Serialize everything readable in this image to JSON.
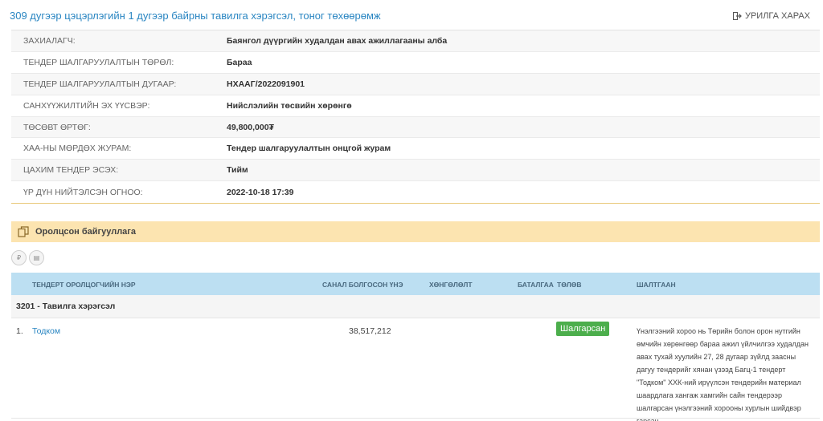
{
  "header": {
    "title": "309 дугээр цэцэрлэгийн 1 дугээр байрны тавилга хэрэгсэл, тоног төхөөрөмж",
    "back_label": "УРИЛГА ХАРАХ"
  },
  "info": [
    {
      "label": "ЗАХИАЛАГЧ:",
      "value": "Баянгол дүүргийн худалдан авах ажиллагааны алба"
    },
    {
      "label": "ТЕНДЕР ШАЛГАРУУЛАЛТЫН ТӨРӨЛ:",
      "value": "Бараа"
    },
    {
      "label": "ТЕНДЕР ШАЛГАРУУЛАЛТЫН ДУГААР:",
      "value": "НХААГ/2022091901"
    },
    {
      "label": "САНХҮҮЖИЛТИЙН ЭХ ҮҮСВЭР:",
      "value": "Нийслэлийн төсвийн хөрөнгө"
    },
    {
      "label": "ТӨСӨВТ ӨРТӨГ:",
      "value": "49,800,000₮"
    },
    {
      "label": "ХАА-НЫ МӨРДӨХ ЖУРАМ:",
      "value": "Тендер шалгаруулалтын онцгой журам"
    },
    {
      "label": "ЦАХИМ ТЕНДЕР ЭСЭХ:",
      "value": "Тийм"
    },
    {
      "label": "ҮР ДҮН НИЙТЭЛСЭН ОГНОО:",
      "value": "2022-10-18 17:39"
    }
  ],
  "section": {
    "title": "Оролцсон байгууллага"
  },
  "mini_buttons": [
    "₽",
    "▤"
  ],
  "table": {
    "columns": {
      "name": "ТЕНДЕРТ ОРОЛЦОГЧИЙН НЭР",
      "price": "САНАЛ БОЛГОСОН ҮНЭ",
      "discount": "ХӨНГӨЛӨЛТ",
      "guarantee": "БАТАЛГАА",
      "status": "ТӨЛӨВ",
      "reason": "ШАЛТГААН"
    },
    "group": "3201 - Тавилга хэрэгсэл",
    "rows": [
      {
        "num": "1.",
        "org": "Тодком",
        "price": "38,517,212",
        "status": "Шалгарсан",
        "reason": "Үнэлгээний хороо нь Төрийн болон орон нутгийн өмчийн хөрөнгөөр бараа ажил үйлчилгээ худалдан авах тухай хуулийн 27, 28 дугаар зүйлд заасны дагуу тендерийг хянан үзээд Багц-1 тендерт \"Тодком\" ХХК-ний ирүүлсэн тендерийн материал шаардлага хангаж хамгийн сайн тендерээр шалгарсан үнэлгээний хорооны хурлын шийдвэр гарсан."
      }
    ]
  },
  "colors": {
    "link": "#2a86c2",
    "section_bg": "#fce4b0",
    "table_head_bg": "#bcdff2",
    "badge_green": "#4cae4c"
  }
}
